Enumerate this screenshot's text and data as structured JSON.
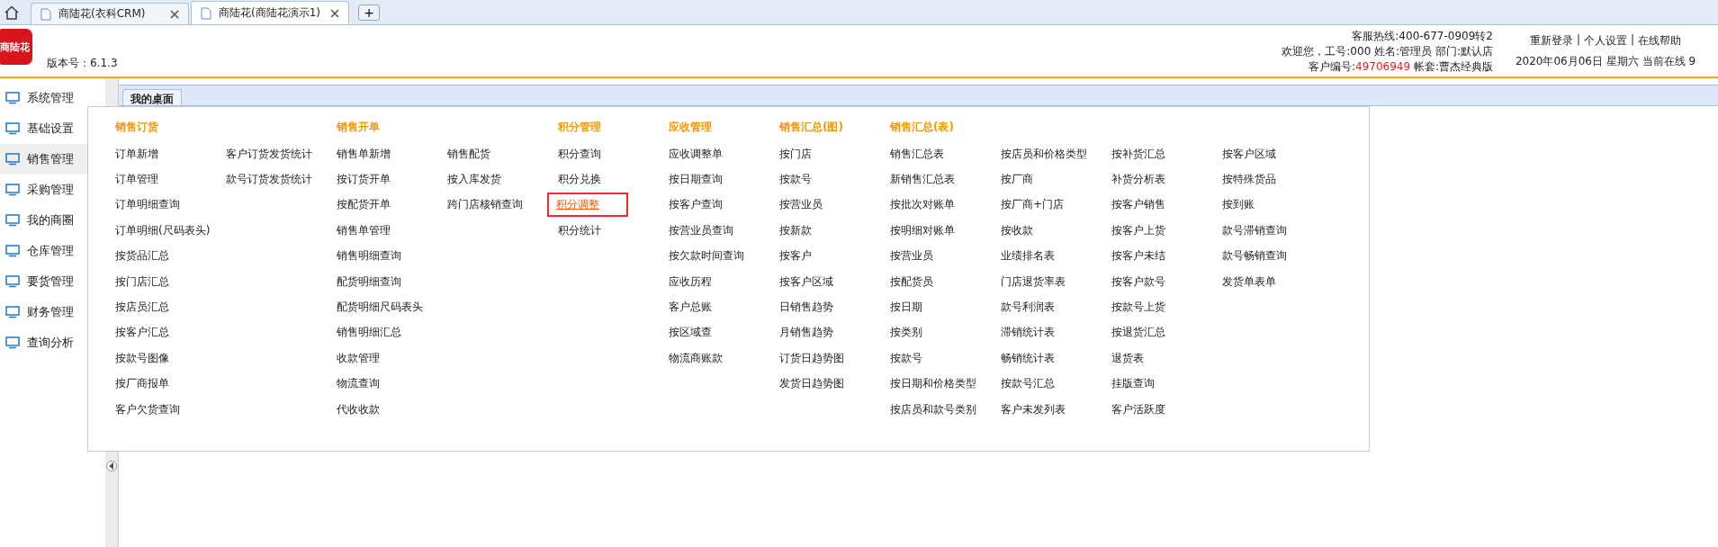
{
  "browser_tabs": [
    {
      "label": "商陆花(衣科CRM)",
      "selected": false
    },
    {
      "label": "商陆花(商陆花演示1)",
      "selected": true
    }
  ],
  "new_tab": "+",
  "header": {
    "logo_text": "商陆花",
    "version": "版本号：6.1.3",
    "hotline": "客服热线:400-677-0909转2",
    "welcome": "欢迎您，工号:000 姓名:管理员 部门:默认店",
    "customer_label": "客户编号:",
    "customer_no": "49706949",
    "account": "帐套:曹杰经典版",
    "links": [
      "重新登录",
      "个人设置",
      "在线帮助"
    ],
    "separator": "|",
    "date_line": "2020年06月06日 星期六 当前在线 9"
  },
  "sidebar": {
    "items": [
      {
        "label": "系统管理",
        "selected": false
      },
      {
        "label": "基础设置",
        "selected": false
      },
      {
        "label": "销售管理",
        "selected": true
      },
      {
        "label": "采购管理",
        "selected": false
      },
      {
        "label": "我的商圈",
        "selected": false
      },
      {
        "label": "仓库管理",
        "selected": false
      },
      {
        "label": "要货管理",
        "selected": false
      },
      {
        "label": "财务管理",
        "selected": false
      },
      {
        "label": "查询分析",
        "selected": false
      }
    ]
  },
  "content_tab": "我的桌面",
  "menu": {
    "groups": [
      {
        "title": "销售订货",
        "columns": [
          [
            {
              "label": "订单新增",
              "selected": false
            },
            {
              "label": "订单管理",
              "selected": false
            },
            {
              "label": "订单明细查询",
              "selected": false
            },
            {
              "label": "订单明细(尺码表头)",
              "selected": false
            },
            {
              "label": "按货品汇总",
              "selected": false
            },
            {
              "label": "按门店汇总",
              "selected": false
            },
            {
              "label": "按店员汇总",
              "selected": false
            },
            {
              "label": "按客户汇总",
              "selected": false
            },
            {
              "label": "按款号图像",
              "selected": false
            },
            {
              "label": "按厂商报单",
              "selected": false
            },
            {
              "label": "客户欠货查询",
              "selected": false
            }
          ],
          [
            {
              "label": "客户订货发货统计",
              "selected": false
            },
            {
              "label": "款号订货发货统计",
              "selected": false
            }
          ]
        ]
      },
      {
        "title": "销售开单",
        "columns": [
          [
            {
              "label": "销售单新增",
              "selected": false
            },
            {
              "label": "按订货开单",
              "selected": false
            },
            {
              "label": "按配货开单",
              "selected": false
            },
            {
              "label": "销售单管理",
              "selected": false
            },
            {
              "label": "销售明细查询",
              "selected": false
            },
            {
              "label": "配货明细查询",
              "selected": false
            },
            {
              "label": "配货明细尺码表头",
              "selected": false
            },
            {
              "label": "销售明细汇总",
              "selected": false
            },
            {
              "label": "收款管理",
              "selected": false
            },
            {
              "label": "物流查询",
              "selected": false
            },
            {
              "label": "代收收款",
              "selected": false
            }
          ],
          [
            {
              "label": "销售配货",
              "selected": false
            },
            {
              "label": "按入库发货",
              "selected": false
            },
            {
              "label": "跨门店核销查询",
              "selected": false
            }
          ]
        ]
      },
      {
        "title": "积分管理",
        "columns": [
          [
            {
              "label": "积分查询",
              "selected": false
            },
            {
              "label": "积分兑换",
              "selected": false
            },
            {
              "label": "积分调整",
              "selected": true
            },
            {
              "label": "积分统计",
              "selected": false
            }
          ]
        ]
      },
      {
        "title": "应收管理",
        "columns": [
          [
            {
              "label": "应收调整单",
              "selected": false
            },
            {
              "label": "按日期查询",
              "selected": false
            },
            {
              "label": "按客户查询",
              "selected": false
            },
            {
              "label": "按营业员查询",
              "selected": false
            },
            {
              "label": "按欠款时间查询",
              "selected": false
            },
            {
              "label": "应收历程",
              "selected": false
            },
            {
              "label": "客户总账",
              "selected": false
            },
            {
              "label": "按区域查",
              "selected": false
            },
            {
              "label": "物流商账款",
              "selected": false
            }
          ]
        ]
      },
      {
        "title": "销售汇总(图)",
        "columns": [
          [
            {
              "label": "按门店",
              "selected": false
            },
            {
              "label": "按款号",
              "selected": false
            },
            {
              "label": "按营业员",
              "selected": false
            },
            {
              "label": "按新款",
              "selected": false
            },
            {
              "label": "按客户",
              "selected": false
            },
            {
              "label": "按客户区域",
              "selected": false
            },
            {
              "label": "日销售趋势",
              "selected": false
            },
            {
              "label": "月销售趋势",
              "selected": false
            },
            {
              "label": "订货日趋势图",
              "selected": false
            },
            {
              "label": "发货日趋势图",
              "selected": false
            }
          ]
        ]
      },
      {
        "title": "销售汇总(表)",
        "columns": [
          [
            {
              "label": "销售汇总表",
              "selected": false
            },
            {
              "label": "新销售汇总表",
              "selected": false
            },
            {
              "label": "按批次对账单",
              "selected": false
            },
            {
              "label": "按明细对账单",
              "selected": false
            },
            {
              "label": "按营业员",
              "selected": false
            },
            {
              "label": "按配货员",
              "selected": false
            },
            {
              "label": "按日期",
              "selected": false
            },
            {
              "label": "按类别",
              "selected": false
            },
            {
              "label": "按款号",
              "selected": false
            },
            {
              "label": "按日期和价格类型",
              "selected": false
            },
            {
              "label": "按店员和款号类别",
              "selected": false
            }
          ],
          [
            {
              "label": "按店员和价格类型",
              "selected": false
            },
            {
              "label": "按厂商",
              "selected": false
            },
            {
              "label": "按厂商+门店",
              "selected": false
            },
            {
              "label": "按收款",
              "selected": false
            },
            {
              "label": "业绩排名表",
              "selected": false
            },
            {
              "label": "门店退货率表",
              "selected": false
            },
            {
              "label": "款号利润表",
              "selected": false
            },
            {
              "label": "滞销统计表",
              "selected": false
            },
            {
              "label": "畅销统计表",
              "selected": false
            },
            {
              "label": "按款号汇总",
              "selected": false
            },
            {
              "label": "客户未发列表",
              "selected": false
            }
          ],
          [
            {
              "label": "按补货汇总",
              "selected": false
            },
            {
              "label": "补货分析表",
              "selected": false
            },
            {
              "label": "按客户销售",
              "selected": false
            },
            {
              "label": "按客户上货",
              "selected": false
            },
            {
              "label": "按客户未结",
              "selected": false
            },
            {
              "label": "按客户款号",
              "selected": false
            },
            {
              "label": "按款号上货",
              "selected": false
            },
            {
              "label": "按退货汇总",
              "selected": false
            },
            {
              "label": "退货表",
              "selected": false
            },
            {
              "label": "挂版查询",
              "selected": false
            },
            {
              "label": "客户活跃度",
              "selected": false
            }
          ],
          [
            {
              "label": "按客户区域",
              "selected": false
            },
            {
              "label": "按特殊货品",
              "selected": false
            },
            {
              "label": "按到账",
              "selected": false
            },
            {
              "label": "款号滞销查询",
              "selected": false
            },
            {
              "label": "款号畅销查询",
              "selected": false
            },
            {
              "label": "发货单表单",
              "selected": false
            }
          ]
        ]
      }
    ]
  }
}
